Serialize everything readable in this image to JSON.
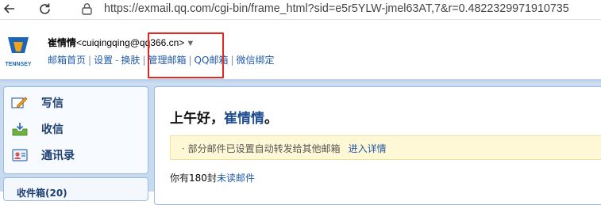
{
  "browser": {
    "url": "https://exmail.qq.com/cgi-bin/frame_html?sid=e5r5YLW-jmel63AT,7&r=0.4822329971910735",
    "back_icon": "arrow-left-icon",
    "reload_icon": "reload-icon",
    "lock_icon": "lock-icon"
  },
  "header": {
    "logo_text": "TENNSEY",
    "user_name": "崔情情",
    "user_email": "<cuiqingqing@qq366.cn>",
    "caret": "▼",
    "links": {
      "home": "邮箱首页",
      "settings": "设置",
      "dash": "-",
      "skin": "换肤",
      "manage": "管理邮箱",
      "qq_mail": "QQ邮箱",
      "wechat_bind": "微信绑定"
    },
    "separator": "|",
    "highlight_color": "#e3261f"
  },
  "sidebar": {
    "items": [
      {
        "label": "写信",
        "icon": "compose-icon"
      },
      {
        "label": "收信",
        "icon": "inbox-icon"
      },
      {
        "label": "通讯录",
        "icon": "contacts-icon"
      }
    ],
    "folder_label": "收件箱(20)"
  },
  "main": {
    "greeting_prefix": "上午好，",
    "greeting_name": "崔情情",
    "greeting_suffix": "。",
    "notice_text": "· 部分邮件已设置自动转发给其他邮箱",
    "notice_link": "进入详情",
    "unread_prefix": "你有",
    "unread_count": "180",
    "unread_mid": "封",
    "unread_link": "未读邮件"
  },
  "colors": {
    "accent_blue": "#1f5aa6",
    "band_blue": "#c8daef",
    "notice_bg": "#fff8d6"
  }
}
